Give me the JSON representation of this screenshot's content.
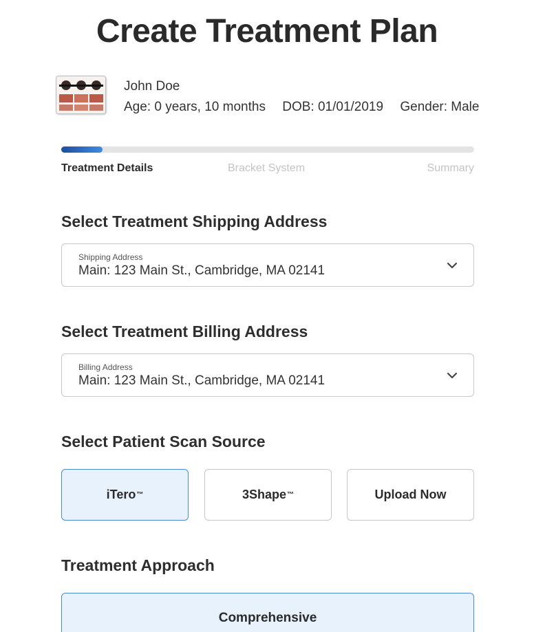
{
  "page": {
    "title": "Create Treatment Plan"
  },
  "patient": {
    "name": "John Doe",
    "age": "Age: 0 years, 10 months",
    "dob": "DOB: 01/01/2019",
    "gender": "Gender: Male",
    "avatar_icon": "dental-photo-collage-icon"
  },
  "progress": {
    "value_fraction": 0.1,
    "steps": [
      "Treatment Details",
      "Bracket System",
      "Summary"
    ],
    "active_step": 0
  },
  "shipping": {
    "heading": "Select Treatment Shipping Address",
    "field_label": "Shipping Address",
    "value": "Main: 123 Main St., Cambridge, MA 02141"
  },
  "billing": {
    "heading": "Select Treatment Billing Address",
    "field_label": "Billing Address",
    "value": "Main: 123 Main St., Cambridge, MA 02141"
  },
  "scan_source": {
    "heading": "Select Patient Scan Source",
    "options": [
      {
        "label": "iTero",
        "mark": "™",
        "selected": true
      },
      {
        "label": "3Shape",
        "mark": "™",
        "selected": false
      },
      {
        "label": "Upload Now",
        "mark": "",
        "selected": false
      }
    ]
  },
  "approach": {
    "heading": "Treatment Approach",
    "selected_option": "Comprehensive"
  },
  "colors": {
    "accent": "#4a8ad4",
    "selected_bg": "#e8f2fd",
    "progress_fill": "#1d4f9c"
  }
}
